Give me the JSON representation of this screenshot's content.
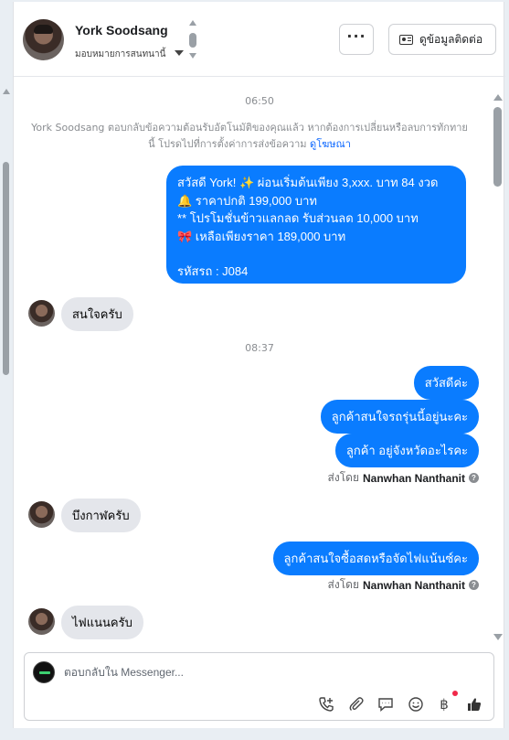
{
  "header": {
    "contact_name": "York Soodsang",
    "assign_label": "มอบหมายการสนทนานี้",
    "more_label": "···",
    "contact_info_label": "ดูข้อมูลติดต่อ"
  },
  "conversation": {
    "timestamp_1": "06:50",
    "system_note": "York Soodsang ตอบกลับข้อความต้อนรับอัตโนมัติของคุณแล้ว หากต้องการเปลี่ยนหรือลบการทักทายนี้ โปรดไปที่การตั้งค่าการส่งข้อความ",
    "system_link": "ดูโฆษณา",
    "promo_lines": [
      "สวัสดี York! ✨  ผ่อนเริ่มต้นเพียง 3,xxx. บาท 84 งวด",
      "🔔 ราคาปกติ 199,000 บาท",
      "** โปรโมชั่นข้าวแลกลด รับส่วนลด 10,000 บาท",
      "🎀  เหลือเพียงราคา 189,000 บาท",
      "รหัสรถ : J084"
    ],
    "reply_1": "สนใจครับ",
    "timestamp_2": "08:37",
    "out_1": "สวัสดีค่ะ",
    "out_2": "ลูกค้าสนใจรถรุ่นนี้อยู่นะคะ",
    "out_3": "ลูกค้า อยู่จังหวัดอะไรคะ",
    "sent_by_prefix": "ส่งโดย",
    "sent_by_name": "Nanwhan Nanthanit",
    "reply_2": "บึงกาฬครับ",
    "out_4": "ลูกค้าสนใจซื้อสดหรือจัดไฟแน้นซ์คะ",
    "reply_3": "ไฟแนนครับ"
  },
  "composer": {
    "placeholder": "ตอบกลับใน Messenger...",
    "tools": [
      "phone-plus-icon",
      "paperclip-icon",
      "chat-bubble-icon",
      "emoji-icon",
      "baht-icon",
      "thumbs-up-icon"
    ]
  },
  "colors": {
    "outgoing_bubble": "#0a7cff",
    "incoming_bubble": "#e4e6eb",
    "link": "#0a66ff"
  }
}
